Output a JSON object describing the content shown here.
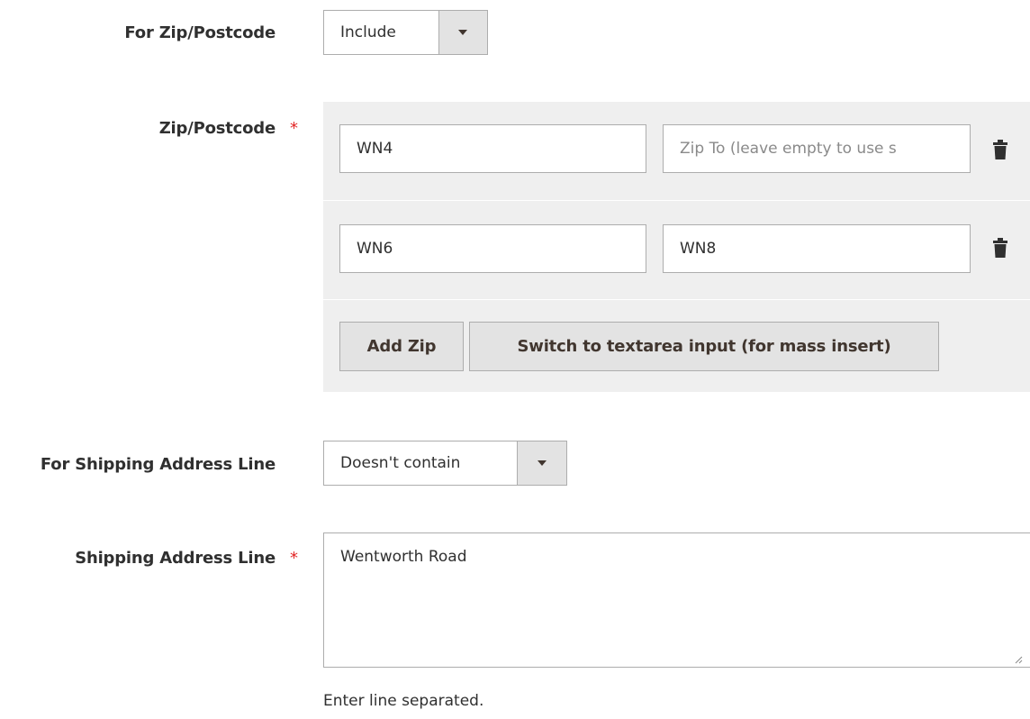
{
  "zip_filter": {
    "label": "For Zip/Postcode",
    "selected": "Include"
  },
  "zip_list": {
    "label": "Zip/Postcode",
    "required_mark": "*",
    "rows": [
      {
        "from": "WN4",
        "to": "",
        "to_placeholder": "Zip To (leave empty to use s"
      },
      {
        "from": "WN6",
        "to": "WN8",
        "to_placeholder": ""
      }
    ],
    "add_button": "Add Zip",
    "switch_button": "Switch to textarea input (for mass insert)"
  },
  "address_filter": {
    "label": "For Shipping Address Line",
    "selected": "Doesn't contain"
  },
  "address_line": {
    "label": "Shipping Address Line",
    "required_mark": "*",
    "value": "Wentworth Road",
    "note": "Enter line separated."
  },
  "icons": {
    "dropdown": "chevron-down-icon",
    "delete": "trash-icon",
    "resize": "resize-grip-icon"
  }
}
